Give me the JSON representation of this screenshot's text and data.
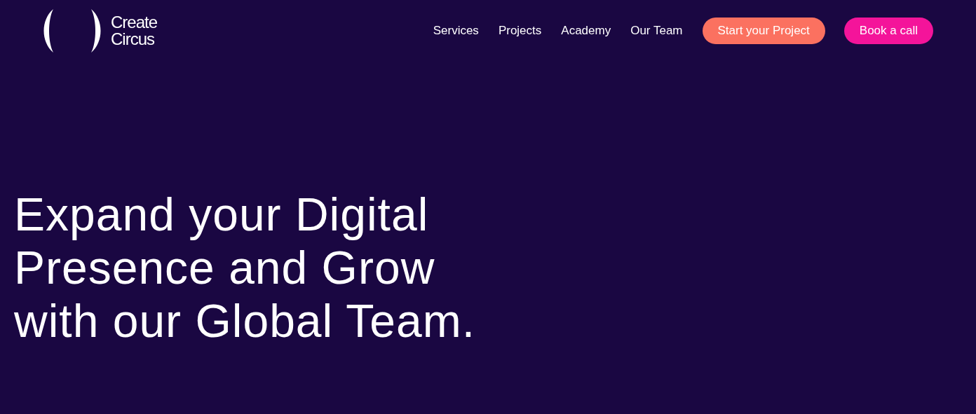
{
  "logo": {
    "lines": [
      "Create",
      "Circus"
    ]
  },
  "nav": [
    {
      "label": "Services"
    },
    {
      "label": "Projects"
    },
    {
      "label": "Academy"
    },
    {
      "label": "Our Team"
    }
  ],
  "buttons": [
    {
      "label": "Start your Project",
      "color": "#fb7160"
    },
    {
      "label": "Book a call",
      "color": "#f4149a"
    }
  ],
  "headline": [
    "Expand your Digital",
    "Presence and Grow",
    "with our Global Team."
  ]
}
